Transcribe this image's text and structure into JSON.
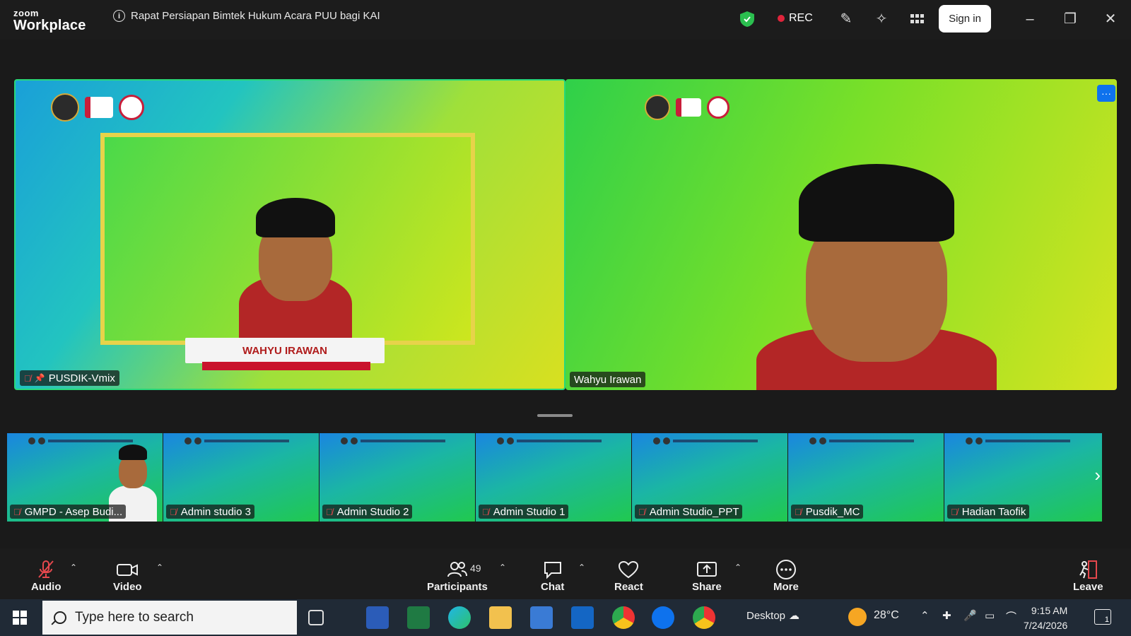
{
  "app": {
    "brand_top": "zoom",
    "brand_bottom": "Workplace",
    "meeting_title": "Rapat Persiapan Bimtek Hukum Acara PUU bagi KAI"
  },
  "titlebar": {
    "rec_label": "REC",
    "signin_label": "Sign in"
  },
  "stage": {
    "left_tile_name": "PUSDIK-Vmix",
    "right_tile_name": "Wahyu Irawan",
    "lower_third_name": "WAHYU IRAWAN",
    "more_label": "···"
  },
  "gallery": [
    {
      "name": "GMPD - Asep Budi..."
    },
    {
      "name": "Admin studio 3"
    },
    {
      "name": "Admin Studio 2"
    },
    {
      "name": "Admin Studio 1"
    },
    {
      "name": "Admin Studio_PPT"
    },
    {
      "name": "Pusdik_MC"
    },
    {
      "name": "Hadian Taofik"
    }
  ],
  "toolbar": {
    "audio": "Audio",
    "video": "Video",
    "participants": "Participants",
    "participants_count": "49",
    "chat": "Chat",
    "react": "React",
    "share": "Share",
    "more": "More",
    "leave": "Leave"
  },
  "taskbar": {
    "search_placeholder": "Type here to search",
    "desktop_label": "Desktop",
    "temperature": "28°C",
    "time": "9:15 AM",
    "date": "7/24/2026",
    "notification_count": "1"
  },
  "colors": {
    "accent": "#0e72ed",
    "active_speaker": "#28d87a",
    "rec": "#e0243b",
    "leave": "#e5484d"
  }
}
